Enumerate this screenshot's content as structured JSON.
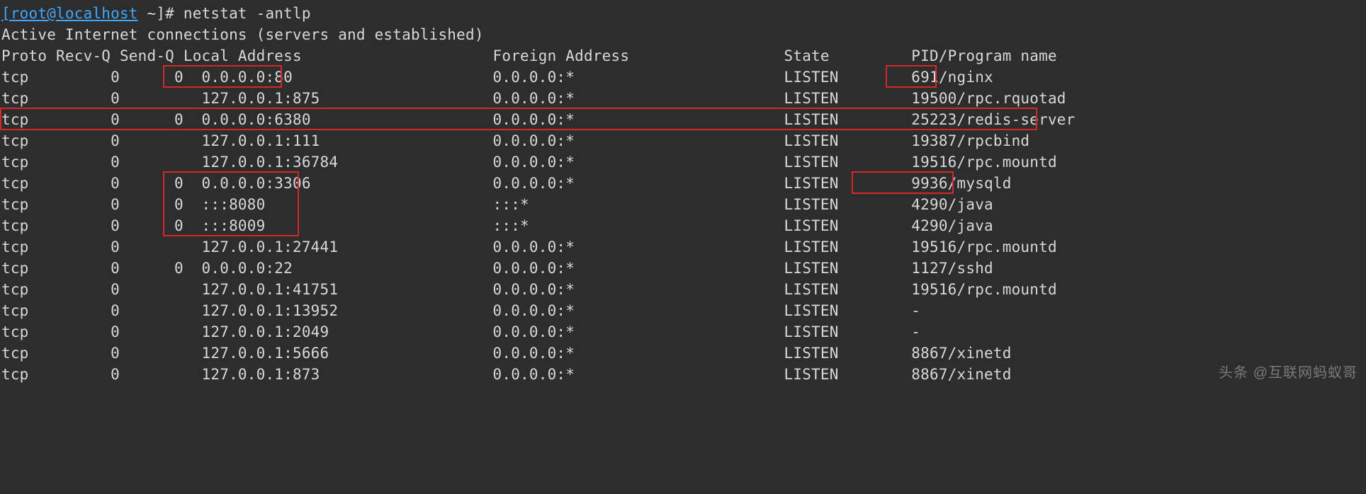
{
  "prompt": {
    "user": "[root@localhost",
    "path": " ~]# ",
    "command": "netstat -antlp"
  },
  "header_line": "Active Internet connections (servers and established)",
  "columns": {
    "proto": "Proto",
    "recvq": "Recv-Q",
    "sendq": "Send-Q",
    "local": "Local Address",
    "foreign": "Foreign Address",
    "state": "State",
    "pid": "PID/Program name"
  },
  "rows": [
    {
      "proto": "tcp",
      "recvq": "0",
      "sendq": "0",
      "local": "0.0.0.0:80",
      "foreign": "0.0.0.0:*",
      "state": "LISTEN",
      "pid": "691/nginx"
    },
    {
      "proto": "tcp",
      "recvq": "0",
      "sendq": "",
      "local": "127.0.0.1:875",
      "foreign": "0.0.0.0:*",
      "state": "LISTEN",
      "pid": "19500/rpc.rquotad"
    },
    {
      "proto": "tcp",
      "recvq": "0",
      "sendq": "0",
      "local": "0.0.0.0:6380",
      "foreign": "0.0.0.0:*",
      "state": "LISTEN",
      "pid": "25223/redis-server"
    },
    {
      "proto": "tcp",
      "recvq": "0",
      "sendq": "",
      "local": "127.0.0.1:111",
      "foreign": "0.0.0.0:*",
      "state": "LISTEN",
      "pid": "19387/rpcbind"
    },
    {
      "proto": "tcp",
      "recvq": "0",
      "sendq": "",
      "local": "127.0.0.1:36784",
      "foreign": "0.0.0.0:*",
      "state": "LISTEN",
      "pid": "19516/rpc.mountd"
    },
    {
      "proto": "tcp",
      "recvq": "0",
      "sendq": "0",
      "local": "0.0.0.0:3306",
      "foreign": "0.0.0.0:*",
      "state": "LISTEN",
      "pid": "9936/mysqld"
    },
    {
      "proto": "tcp",
      "recvq": "0",
      "sendq": "0",
      "local": ":::8080",
      "foreign": ":::*",
      "state": "LISTEN",
      "pid": "4290/java"
    },
    {
      "proto": "tcp",
      "recvq": "0",
      "sendq": "0",
      "local": ":::8009",
      "foreign": ":::*",
      "state": "LISTEN",
      "pid": "4290/java"
    },
    {
      "proto": "tcp",
      "recvq": "0",
      "sendq": "",
      "local": "127.0.0.1:27441",
      "foreign": "0.0.0.0:*",
      "state": "LISTEN",
      "pid": "19516/rpc.mountd"
    },
    {
      "proto": "tcp",
      "recvq": "0",
      "sendq": "0",
      "local": "0.0.0.0:22",
      "foreign": "0.0.0.0:*",
      "state": "LISTEN",
      "pid": "1127/sshd"
    },
    {
      "proto": "tcp",
      "recvq": "0",
      "sendq": "",
      "local": "127.0.0.1:41751",
      "foreign": "0.0.0.0:*",
      "state": "LISTEN",
      "pid": "19516/rpc.mountd"
    },
    {
      "proto": "tcp",
      "recvq": "0",
      "sendq": "",
      "local": "127.0.0.1:13952",
      "foreign": "0.0.0.0:*",
      "state": "LISTEN",
      "pid": "-"
    },
    {
      "proto": "tcp",
      "recvq": "0",
      "sendq": "",
      "local": "127.0.0.1:2049",
      "foreign": "0.0.0.0:*",
      "state": "LISTEN",
      "pid": "-"
    },
    {
      "proto": "tcp",
      "recvq": "0",
      "sendq": "",
      "local": "127.0.0.1:5666",
      "foreign": "0.0.0.0:*",
      "state": "LISTEN",
      "pid": "8867/xinetd"
    },
    {
      "proto": "tcp",
      "recvq": "0",
      "sendq": "",
      "local": "127.0.0.1:873",
      "foreign": "0.0.0.0:*",
      "state": "LISTEN",
      "pid": "8867/xinetd"
    }
  ],
  "col_positions": {
    "proto": 0,
    "recvq": 13,
    "sendq": 20,
    "local": 22,
    "foreign": 54,
    "state": 86,
    "pid": 100
  },
  "highlights": {
    "row_full": [
      2
    ],
    "sendq_local": [
      0,
      5,
      6,
      7
    ],
    "pid": [
      0,
      5
    ]
  },
  "watermark": "头条 @互联网蚂蚁哥"
}
